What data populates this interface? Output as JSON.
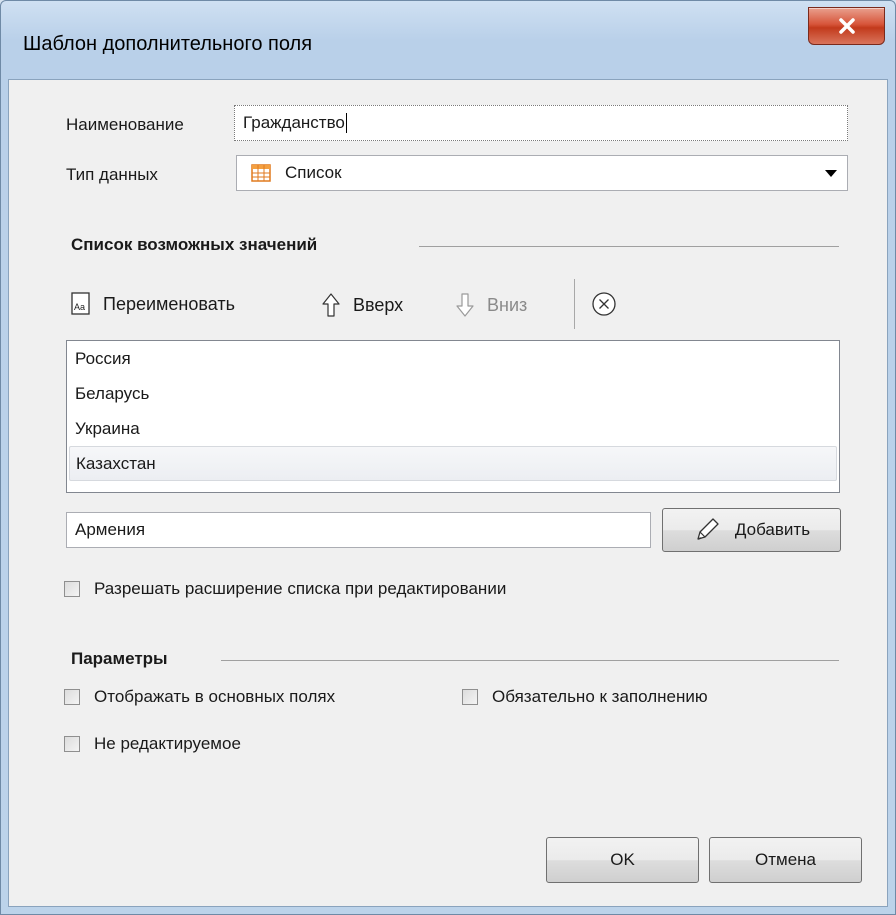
{
  "window": {
    "title": "Шаблон дополнительного поля"
  },
  "form": {
    "name_label": "Наименование",
    "name_value": "Гражданство",
    "type_label": "Тип данных",
    "type_value": "Список"
  },
  "values_section": {
    "title": "Список возможных значений",
    "toolbar": {
      "rename_label": "Переименовать",
      "up_label": "Вверх",
      "down_label": "Вниз"
    },
    "items": [
      "Россия",
      "Беларусь",
      "Украина",
      "Казахстан"
    ],
    "selected_index": 3,
    "new_value": "Армения",
    "add_label": "Добавить",
    "allow_extend_label": "Разрешать расширение списка при редактировании",
    "allow_extend_checked": false
  },
  "params_section": {
    "title": "Параметры",
    "show_in_main_label": "Отображать в основных полях",
    "required_label": "Обязательно к заполнению",
    "readonly_label": "Не редактируемое"
  },
  "buttons": {
    "ok": "OK",
    "cancel": "Отмена"
  }
}
